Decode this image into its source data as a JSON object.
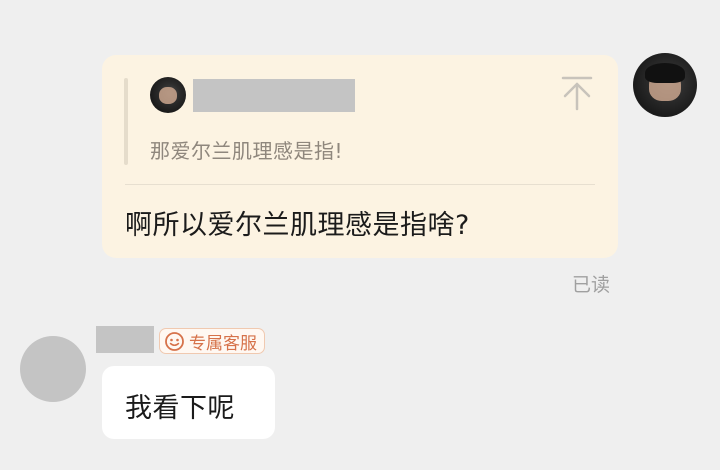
{
  "conversation": {
    "sent_message": {
      "quote": {
        "avatar_icon": "user-avatar-photo",
        "icon": "arrow-up-to-top-icon",
        "text": "那爱尔兰肌理感是指!"
      },
      "text": "啊所以爱尔兰肌理感是指啥?",
      "read_status": "已读",
      "sender_avatar": "user-avatar-photo",
      "bubble_color": "#fcf3e2"
    },
    "received_message": {
      "avatar": "agent-avatar-placeholder",
      "badge": {
        "icon": "smiley-badge-icon",
        "label": "专属客服",
        "color": "#d6724a"
      },
      "text": "我看下呢",
      "bubble_color": "#ffffff"
    }
  }
}
